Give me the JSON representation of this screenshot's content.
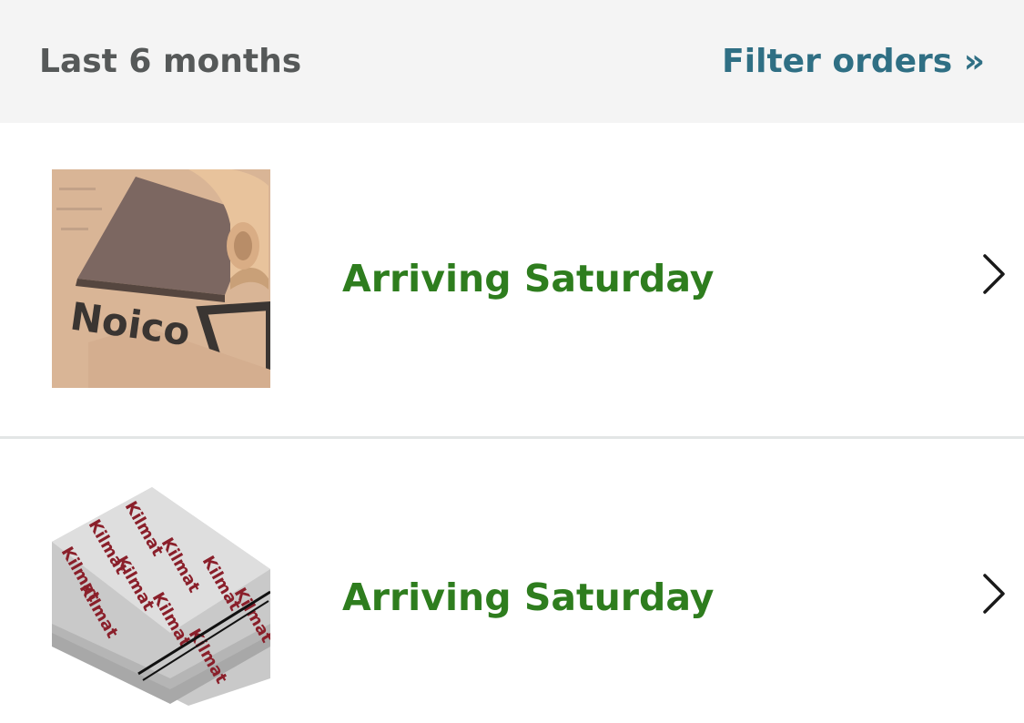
{
  "header": {
    "range_label": "Last 6 months",
    "filter_link": "Filter orders »"
  },
  "orders": [
    {
      "status": "Arriving Saturday",
      "thumbnail_icon": "noico-sound-deadener-product-image",
      "thumbnail_brand_text": "Noico",
      "chevron_icon": "chevron-right-icon"
    },
    {
      "status": "Arriving Saturday",
      "thumbnail_icon": "kilmat-sound-deadener-product-image",
      "thumbnail_brand_text": "Kilmat",
      "chevron_icon": "chevron-right-icon"
    }
  ],
  "colors": {
    "header_bg": "#f4f4f4",
    "range_label": "#565959",
    "filter_link": "#2f6f84",
    "status_green": "#2e7d1e",
    "divider": "#e3e6e6"
  }
}
